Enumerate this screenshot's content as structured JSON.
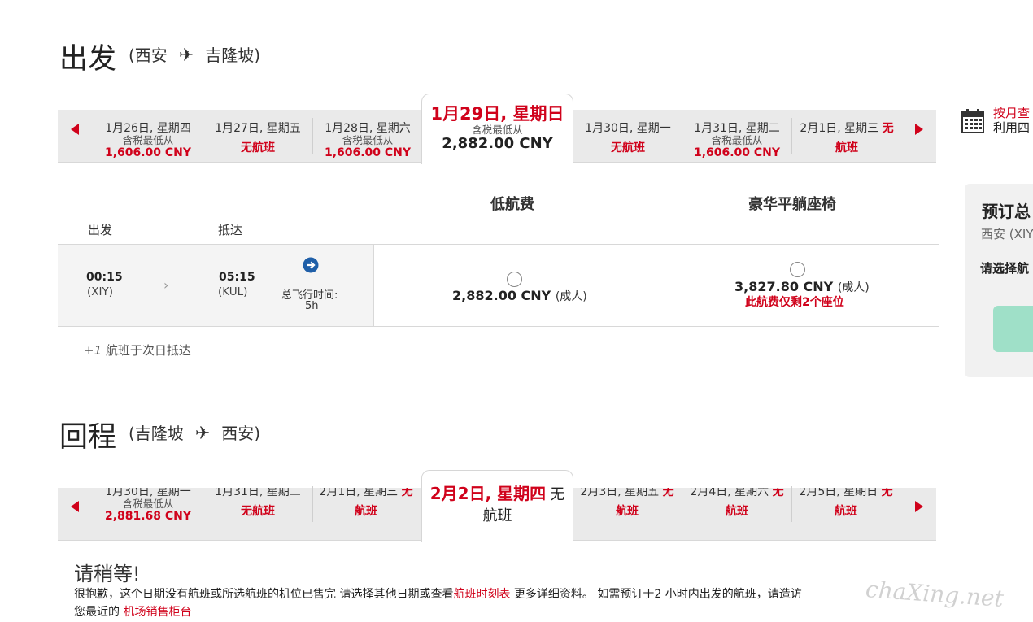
{
  "outbound": {
    "title": "出发",
    "from": "(西安",
    "to": "吉隆坡)",
    "dates": [
      {
        "date": "1月26日, 星期四",
        "sub": "含税最低从",
        "price": "1,606.00 CNY"
      },
      {
        "date": "1月27日, 星期五",
        "no_flight": "无航班"
      },
      {
        "date": "1月28日, 星期六",
        "sub": "含税最低从",
        "price": "1,606.00 CNY"
      },
      {
        "date": "1月29日, 星期日",
        "sub": "含税最低从",
        "price": "2,882.00 CNY"
      },
      {
        "date": "1月30日, 星期一",
        "no_flight": "无航班"
      },
      {
        "date": "1月31日, 星期二",
        "sub": "含税最低从",
        "price": "1,606.00 CNY"
      },
      {
        "date": "2月1日, 星期三",
        "suffix": "无",
        "no_flight": "航班"
      }
    ]
  },
  "calendar": {
    "line1": "按月查",
    "line2": "利用四"
  },
  "flight_table": {
    "fare_low": "低航费",
    "fare_premium": "豪华平躺座椅",
    "depart_label": "出发",
    "arrive_label": "抵达",
    "depart_time": "00:15",
    "depart_code": "(XIY)",
    "arrive_time": "05:15",
    "arrive_code": "(KUL)",
    "duration_label": "总飞行时间:",
    "duration": "5h",
    "low_price": "2,882.00 CNY",
    "low_pax": "(成人)",
    "premium_price": "3,827.80 CNY",
    "premium_pax": "(成人)",
    "seats_left": "此航费仅剩2个座位",
    "next_day_mark": "+1",
    "next_day_note": "航班于次日抵达"
  },
  "summary": {
    "title": "预订总",
    "route": "西安 (XIY",
    "prompt": "请选择航"
  },
  "return": {
    "title": "回程",
    "from": "(吉隆坡",
    "to": "西安)",
    "dates": [
      {
        "date": "1月30日, 星期一",
        "sub": "含税最低从",
        "price": "2,881.68 CNY"
      },
      {
        "date": "1月31日, 星期二",
        "no_flight": "无航班"
      },
      {
        "date": "2月1日, 星期三",
        "suffix": "无",
        "no_flight": "航班"
      },
      {
        "date": "2月2日, 星期四",
        "suffix": "无",
        "no_flight": "航班"
      },
      {
        "date": "2月3日, 星期五",
        "suffix": "无",
        "no_flight": "航班"
      },
      {
        "date": "2月4日, 星期六",
        "suffix": "无",
        "no_flight": "航班"
      },
      {
        "date": "2月5日, 星期日",
        "suffix": "无",
        "no_flight": "航班"
      }
    ]
  },
  "notice": {
    "title": "请稍等!",
    "text1": "很抱歉，这个日期没有航班或所选航班的机位已售完 请选择其他日期或查看",
    "link1": "航班时刻表",
    "text2": "更多详细资料。 如需预订于2 小时内出发的航班，请造访",
    "text3": "您最近的",
    "link2": "机场销售柜台"
  },
  "watermark": "chaXing.net",
  "colors": {
    "accent": "#d0021b",
    "strip": "#eaeaea",
    "cta": "#9fe0c8"
  }
}
